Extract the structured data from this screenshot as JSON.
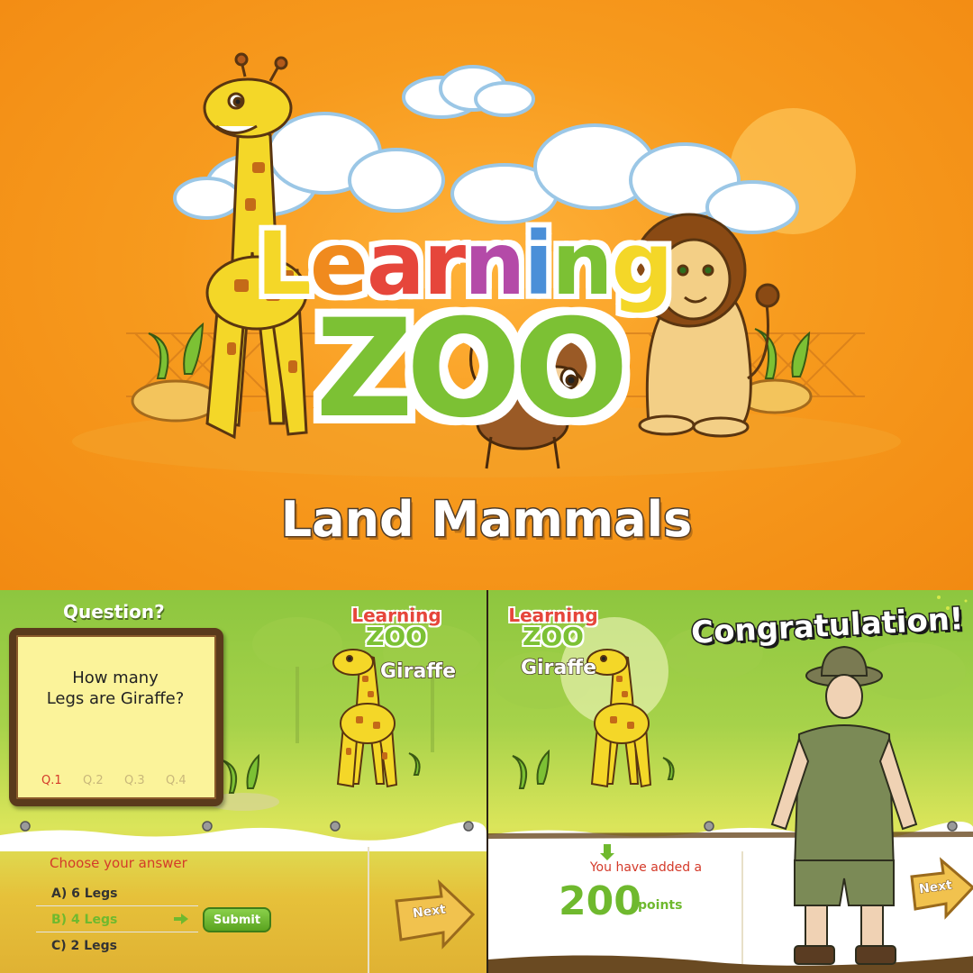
{
  "hero": {
    "logo_top": "Learning",
    "logo_bottom": "ZOO",
    "subtitle": "Land Mammals"
  },
  "question_panel": {
    "heading": "Question?",
    "logo_top": "Learning",
    "logo_bottom": "ZOO",
    "animal": "Giraffe",
    "question_line1": "How many",
    "question_line2": "Legs are Giraffe?",
    "steps": [
      "Q.1",
      "Q.2",
      "Q.3",
      "Q.4"
    ],
    "active_step": "Q.1",
    "choose_label": "Choose your answer",
    "options": [
      {
        "label": "A)  6 Legs",
        "selected": false
      },
      {
        "label": "B)  4 Legs",
        "selected": true
      },
      {
        "label": "C)  2 Legs",
        "selected": false
      }
    ],
    "submit_label": "Submit",
    "next_label": "Next"
  },
  "result_panel": {
    "logo_top": "Learning",
    "logo_bottom": "ZOO",
    "animal": "Giraffe",
    "congrats": "Congratulation!",
    "added_text": "You have added a",
    "points_value": "200",
    "points_unit": "points",
    "next_label": "Next"
  },
  "colors": {
    "hero_orange": "#f79b1e",
    "grass_green": "#8dc63f",
    "accent_red": "#d43a2a",
    "accent_green": "#6fb92e",
    "board_yellow": "#fbf39a",
    "board_brown": "#5a3a1c"
  }
}
